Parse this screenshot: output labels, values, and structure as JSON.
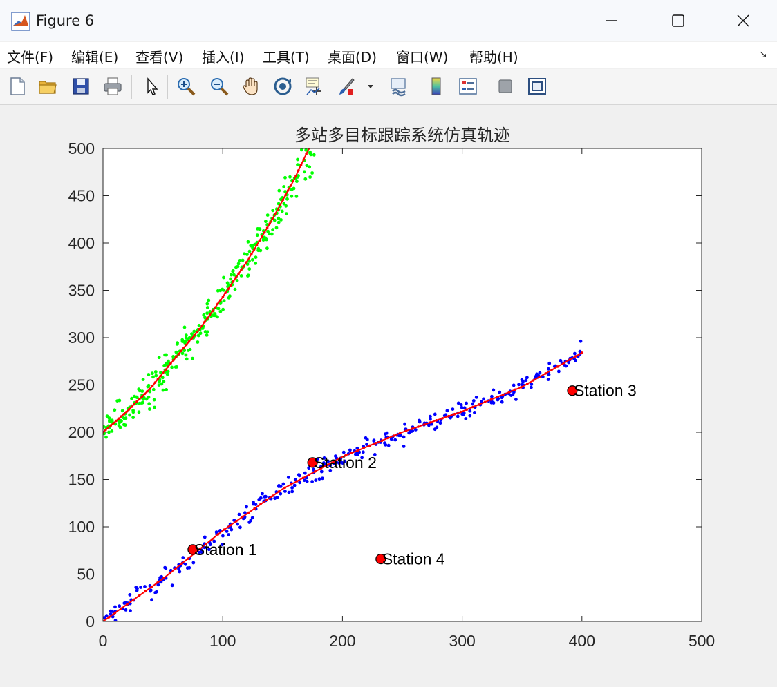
{
  "window": {
    "title": "Figure 6"
  },
  "menu": [
    "文件(F)",
    "编辑(E)",
    "查看(V)",
    "插入(I)",
    "工具(T)",
    "桌面(D)",
    "窗口(W)",
    "帮助(H)"
  ],
  "toolbar": [
    "new-file-icon",
    "open-folder-icon",
    "save-icon",
    "print-icon",
    "pointer-icon",
    "zoom-in-icon",
    "zoom-out-icon",
    "pan-hand-icon",
    "rotate-3d-icon",
    "data-cursor-icon",
    "brush-icon",
    "link-plot-icon",
    "colorbar-icon",
    "legend-icon",
    "hide-plot-tools-icon",
    "show-plot-tools-icon"
  ],
  "colors": {
    "green_obs": "#00ff00",
    "blue_obs": "#0000ff",
    "track": "#ff0000",
    "station": "#ff0000"
  },
  "chart_data": {
    "type": "scatter",
    "title": "多站多目标跟踪系统仿真轨迹",
    "xlim": [
      0,
      500
    ],
    "ylim": [
      0,
      500
    ],
    "xticks": [
      0,
      100,
      200,
      300,
      400,
      500
    ],
    "yticks": [
      0,
      50,
      100,
      150,
      200,
      250,
      300,
      350,
      400,
      450,
      500
    ],
    "series": [
      {
        "kind": "observations",
        "color": "#00ff00",
        "note": "noisy points scattered around the upper track",
        "x": [
          0,
          20,
          40,
          60,
          80,
          100,
          120,
          140,
          160,
          172
        ],
        "y": [
          200,
          222,
          247,
          278,
          308,
          343,
          380,
          422,
          468,
          500
        ]
      },
      {
        "kind": "track",
        "color": "#ff0000",
        "x": [
          0,
          20,
          40,
          60,
          80,
          100,
          120,
          140,
          160,
          172
        ],
        "y": [
          200,
          222,
          247,
          278,
          308,
          343,
          380,
          422,
          468,
          500
        ]
      },
      {
        "kind": "observations",
        "color": "#0000ff",
        "note": "noisy points scattered around the lower track",
        "x": [
          0,
          50,
          100,
          150,
          200,
          250,
          300,
          350,
          400
        ],
        "y": [
          0,
          45,
          96,
          140,
          174,
          200,
          222,
          248,
          284
        ]
      },
      {
        "kind": "track",
        "color": "#ff0000",
        "x": [
          0,
          50,
          100,
          150,
          200,
          250,
          300,
          350,
          400
        ],
        "y": [
          0,
          45,
          96,
          140,
          174,
          200,
          222,
          248,
          284
        ]
      }
    ],
    "stations": [
      {
        "name": "Station 1",
        "x": 75,
        "y": 76
      },
      {
        "name": "Station 2",
        "x": 175,
        "y": 168
      },
      {
        "name": "Station 3",
        "x": 392,
        "y": 244
      },
      {
        "name": "Station 4",
        "x": 232,
        "y": 66
      }
    ]
  }
}
